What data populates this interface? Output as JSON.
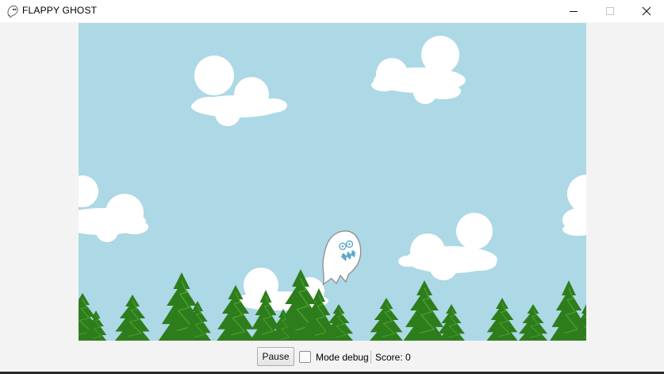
{
  "window": {
    "title": "FLAPPY GHOST",
    "icon": "ghost-app-icon",
    "buttons": [
      "minimize-icon",
      "maximize-icon",
      "close-icon"
    ]
  },
  "game": {
    "sky_color": "#add8e6",
    "cloud_color": "#ffffff",
    "tree_color": "#2e7d1c",
    "ghost_color": "#ffffff",
    "ghost_accent": "#5fa8c8"
  },
  "controls": {
    "pause_label": "Pause",
    "debug_label": "Mode debug",
    "debug_checked": false,
    "score_text": "Score: 0"
  }
}
